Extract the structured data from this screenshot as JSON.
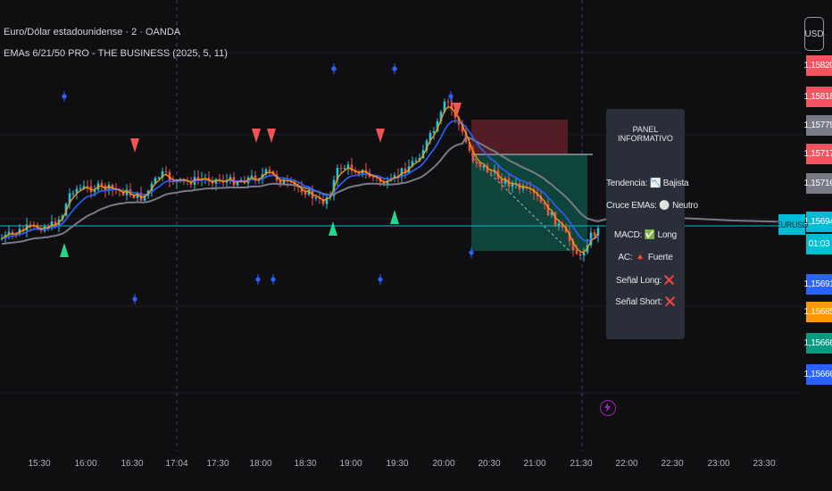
{
  "chart_header": {
    "symbol_line": "Euro/Dólar estadounidense · 2 · OANDA",
    "indicator_line": "EMAs 6/21/50 PRO - THE BUSINESS (2025, 5, 11)"
  },
  "currency_button": "USD",
  "price_scale": [
    {
      "text": "1,15820",
      "color": "#f7525f"
    },
    {
      "text": "1,15818",
      "color": "#f7525f"
    },
    {
      "text": "1,15779",
      "color": "#787b86"
    },
    {
      "text": "1,15717",
      "color": "#f7525f"
    },
    {
      "text": "1,15716",
      "color": "#787b86"
    },
    {
      "text": "1,15694",
      "color": "#00bcd4"
    },
    {
      "text": "01:03",
      "color": "#00bcd4"
    },
    {
      "text": "1,15691",
      "color": "#2962ff"
    },
    {
      "text": "1,15685",
      "color": "#ff9800"
    },
    {
      "text": "1,15666",
      "color": "#089981"
    },
    {
      "text": "1,15666",
      "color": "#2962ff"
    }
  ],
  "symbol_label": "EURUSD",
  "time_axis": [
    "15:30",
    "16:00",
    "16:30",
    "17:04",
    "17:30",
    "18:00",
    "18:30",
    "19:00",
    "19:30",
    "20:00",
    "20:30",
    "21:00",
    "21:30",
    "22:00",
    "22:30",
    "23:00",
    "23:30"
  ],
  "info_panel": {
    "title": "PANEL INFORMATIVO",
    "trend": "Tendencia: 📉 Bajista",
    "ema_cross": "Cruce EMAs: ⚪ Neutro",
    "macd": "MACD: ✅ Long",
    "ac": "AC: 🔺 Fuerte",
    "signal_long": "Señal Long: ❌",
    "signal_short": "Señal Short: ❌"
  },
  "icons": {
    "event": "lightning-icon"
  },
  "colors": {
    "background": "#0f0f11",
    "bull_candle": "#26c6da",
    "bear_candle": "#ef5350",
    "ema_fast": "#ff9800",
    "ema_mid": "#2962ff",
    "ema_slow": "#787b86",
    "buy_signal": "#22d98a",
    "sell_signal": "#f05454",
    "fractal_dot": "#2962ff"
  }
}
